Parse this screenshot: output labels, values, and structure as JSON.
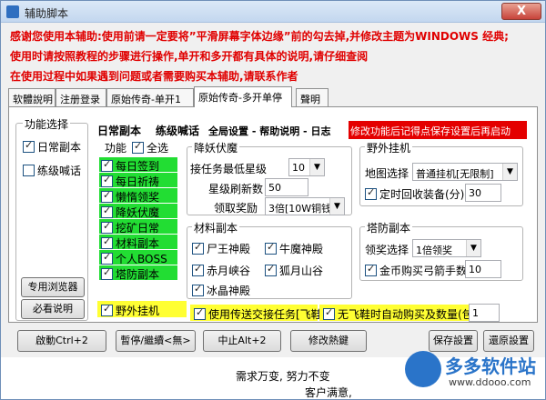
{
  "window": {
    "title": "辅助脚本",
    "close_label": "X"
  },
  "notices": [
    "感谢您使用本辅助:使用前请一定要将”平滑屏幕字体边缘”前的勾去掉,并修改主题为WINDOWS 经典;",
    "使用时请按照教程的步骤进行操作,单开和多开都有具体的说明,请仔细查阅",
    "在使用过程中如果遇到问题或者需要购买本辅助,请联系作者"
  ],
  "tabs": [
    "软體說明",
    "注册登录",
    "原始传奇-单开1",
    "原始传奇-多开单停",
    "聲明"
  ],
  "function_select": {
    "title": "功能选择",
    "daily": "日常副本",
    "leveling": "练级喊话",
    "browser_btn": "专用浏览器",
    "help_btn": "必看说明"
  },
  "subtabs": [
    "日常副本",
    "练级喊话",
    "全局设置 - 帮助说明 - 日志",
    "修改功能后记得点保存设置后再启动"
  ],
  "functions": {
    "header": "功能",
    "select_all": "全选",
    "items": [
      "每日签到",
      "每日祈祷",
      "懒惰领奖",
      "降妖伏魔",
      "挖矿日常",
      "材料副本",
      "个人BOSS",
      "塔防副本"
    ],
    "outside_hangup": "野外挂机"
  },
  "demon": {
    "title": "降妖伏魔",
    "min_star_label": "接任务最低星级",
    "min_star_value": "10",
    "refresh_label": "星级刷新数",
    "refresh_value": "50",
    "reward_label": "领取奖励",
    "reward_value": "3倍[10W铜钱]"
  },
  "material": {
    "title": "材料副本",
    "items": [
      "尸王神殿",
      "牛魔神殿",
      "赤月峡谷",
      "狐月山谷",
      "冰晶神殿"
    ]
  },
  "outside": {
    "title": "野外挂机",
    "map_label": "地图选择",
    "map_value": "普通挂机[无限制]",
    "recycle_label": "定时回收装备(分)",
    "recycle_value": "30"
  },
  "tower": {
    "title": "塔防副本",
    "reward_label": "领奖选择",
    "reward_value": "1倍领奖",
    "buy_label": "金币购买弓箭手数",
    "buy_value": "10"
  },
  "bottom_checks": {
    "teleport": "使用传送交接任务[飞鞋]",
    "auto_buy": "无飞鞋时自动购买及数量(包)",
    "auto_buy_value": "1"
  },
  "buttons": {
    "start": "啟動Ctrl+2",
    "pause": "暫停/繼續<無>",
    "stop": "中止Alt+2",
    "modify_hotkey": "修改熱鍵",
    "save": "保存設置",
    "restore": "還原設置"
  },
  "footer": {
    "slogan": "需求万变, 努力不变",
    "customer": "客户满意,"
  },
  "watermark": {
    "brand": "多多软件站",
    "url": "www.ddooo.com"
  }
}
